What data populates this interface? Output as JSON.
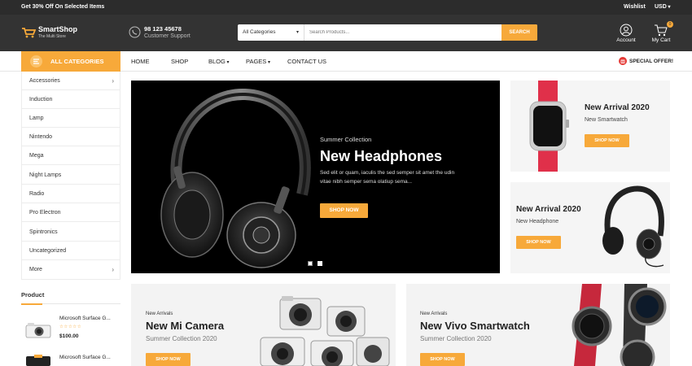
{
  "topbar": {
    "promo": "Get 30% Off On Selected Items",
    "wishlist": "Wishlist",
    "currency": "USD"
  },
  "header": {
    "logo_title": "SmartShop",
    "logo_sub": "The Multi Store",
    "phone": "98 123 45678",
    "support": "Customer Support",
    "category_select": "All Categories",
    "search_placeholder": "Search Products...",
    "search_button": "SEARCH",
    "account": "Account",
    "cart": "My Cart",
    "cart_count": "0"
  },
  "nav": {
    "all_categories": "ALL CATEGORIES",
    "links": [
      "HOME",
      "SHOP",
      "BLOG",
      "PAGES",
      "CONTACT US"
    ],
    "special_offer": "SPECIAL OFFER!"
  },
  "categories": [
    "Accessories",
    "Induction",
    "Lamp",
    "Nintendo",
    "Mega",
    "Night Lamps",
    "Radio",
    "Pro Electron",
    "Spintronics",
    "Uncategorized",
    "More"
  ],
  "product_section": {
    "title": "Product",
    "items": [
      {
        "name": "Microsoft Surface G...",
        "price": "$100.00"
      },
      {
        "name": "Microsoft Surface G..."
      }
    ]
  },
  "hero": {
    "subtitle": "Summer Collection",
    "title": "New Headphones",
    "desc_line1": "Sed elit or quam, iaculis the sed semper sit amet the udin",
    "desc_line2": "vitae nibh semper sema olatiup sema...",
    "button": "SHOP NOW"
  },
  "side_banner_1": {
    "title": "New Arrival 2020",
    "sub": "New Smartwatch",
    "button": "SHOP NOW"
  },
  "side_banner_2": {
    "title": "New Arrival 2020",
    "sub": "New Headphone",
    "button": "SHOP NOW"
  },
  "bottom_banner_1": {
    "eyebrow": "New Arrivals",
    "title": "New Mi Camera",
    "sub": "Summer Collection 2020",
    "button": "SHOP NOW"
  },
  "bottom_banner_2": {
    "eyebrow": "New Arrivals",
    "title": "New Vivo Smartwatch",
    "sub": "Summer Collection 2020",
    "button": "SHOP NOW"
  },
  "colors": {
    "accent": "#f7a93a",
    "dark": "#333333",
    "special": "#e53935"
  },
  "icons": [
    "menu-icon",
    "phone-icon",
    "user-icon",
    "cart-icon",
    "chevron-right-icon",
    "star-icon",
    "gift-icon"
  ]
}
